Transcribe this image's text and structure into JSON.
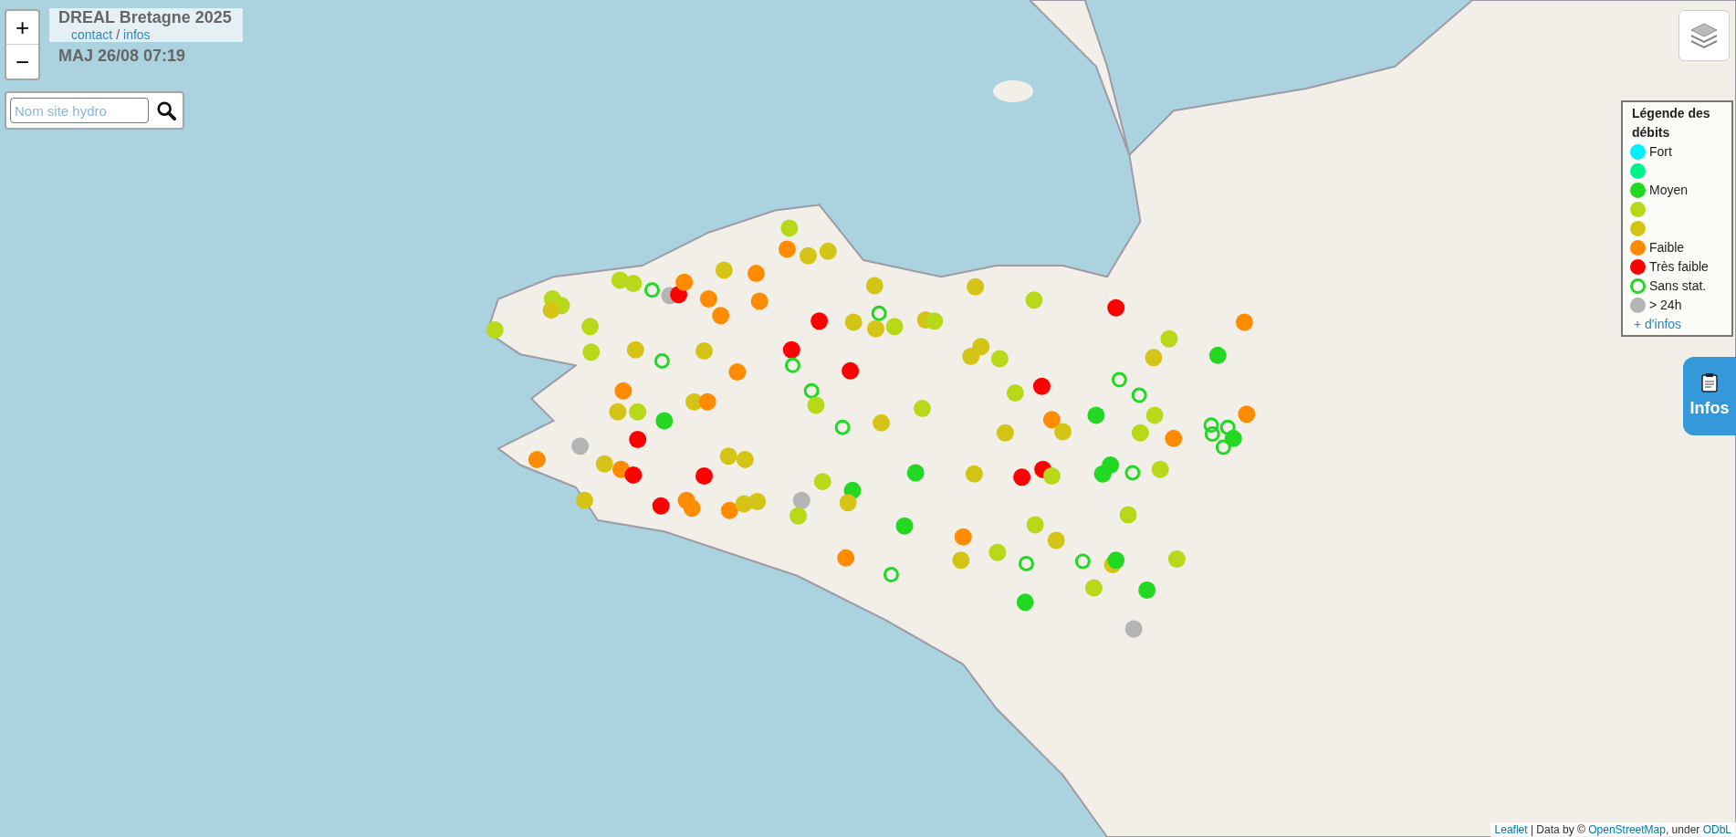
{
  "header": {
    "title": "DREAL Bretagne 2025",
    "links": [
      {
        "label": "contact"
      },
      {
        "label": "infos"
      }
    ],
    "separator": "/",
    "update": "MAJ 26/08 07:19"
  },
  "zoom": {
    "in": "+",
    "out": "−"
  },
  "search": {
    "placeholder": "Nom site hydro"
  },
  "legend": {
    "title": "Légende des débits",
    "more": "+ d'infos",
    "items": [
      {
        "kind": "dot",
        "color": "#00f0ff",
        "label": "Fort"
      },
      {
        "kind": "dot",
        "color": "#00f08c"
      },
      {
        "kind": "dot",
        "color": "#22d822",
        "label": "Moyen"
      },
      {
        "kind": "dot",
        "color": "#b8d81a"
      },
      {
        "kind": "dot",
        "color": "#d4c416"
      },
      {
        "kind": "dot",
        "color": "#ff8c00",
        "label": "Faible"
      },
      {
        "kind": "dot",
        "color": "#ff0000",
        "label": "Très faible"
      },
      {
        "kind": "ring",
        "color": "#22d822",
        "label": "Sans stat."
      },
      {
        "kind": "dot",
        "color": "#b4b4b4",
        "label": "> 24h"
      }
    ]
  },
  "infos_button": {
    "label": "Infos"
  },
  "attribution": {
    "parts": [
      {
        "kind": "link",
        "text": "Leaflet"
      },
      {
        "kind": "text",
        "text": " | Data by © "
      },
      {
        "kind": "link",
        "text": "OpenStreetMap"
      },
      {
        "kind": "text",
        "text": ", under "
      },
      {
        "kind": "link",
        "text": "ODbL"
      }
    ]
  },
  "stations": [
    {
      "kind": "dot",
      "color": "#b8d81a"
    },
    {
      "kind": "dot",
      "color": "#ff8c00"
    },
    {
      "kind": "dot",
      "color": "#d4c416"
    },
    {
      "kind": "dot",
      "color": "#d4c416"
    },
    {
      "kind": "dot",
      "color": "#d4c416"
    },
    {
      "kind": "dot",
      "color": "#ff8c00"
    },
    {
      "kind": "dot",
      "color": "#b8d81a"
    },
    {
      "kind": "dot",
      "color": "#b8d81a"
    },
    {
      "kind": "ring",
      "color": "#22d822"
    },
    {
      "kind": "dot",
      "color": "#b4b4b4"
    },
    {
      "kind": "dot",
      "color": "#ff0000"
    },
    {
      "kind": "dot",
      "color": "#ff8c00"
    },
    {
      "kind": "dot",
      "color": "#ff8c00"
    },
    {
      "kind": "dot",
      "color": "#ff8c00"
    },
    {
      "kind": "dot",
      "color": "#b8d81a"
    },
    {
      "kind": "dot",
      "color": "#b8d81a"
    },
    {
      "kind": "dot",
      "color": "#d4c416"
    },
    {
      "kind": "dot",
      "color": "#b8d81a"
    },
    {
      "kind": "dot",
      "color": "#b8d81a"
    },
    {
      "kind": "dot",
      "color": "#ff8c00"
    },
    {
      "kind": "dot",
      "color": "#ff0000"
    },
    {
      "kind": "dot",
      "color": "#d4c416"
    },
    {
      "kind": "dot",
      "color": "#d4c416"
    },
    {
      "kind": "ring",
      "color": "#22d822"
    },
    {
      "kind": "dot",
      "color": "#d4c416"
    },
    {
      "kind": "dot",
      "color": "#b8d81a"
    },
    {
      "kind": "dot",
      "color": "#d4c416"
    },
    {
      "kind": "dot",
      "color": "#b8d81a"
    },
    {
      "kind": "dot",
      "color": "#d4c416"
    },
    {
      "kind": "dot",
      "color": "#b8d81a"
    },
    {
      "kind": "dot",
      "color": "#ff0000"
    },
    {
      "kind": "dot",
      "color": "#ff8c00"
    },
    {
      "kind": "dot",
      "color": "#b8d81a"
    },
    {
      "kind": "dot",
      "color": "#22d822"
    },
    {
      "kind": "dot",
      "color": "#d4c416"
    },
    {
      "kind": "dot",
      "color": "#d4c416"
    },
    {
      "kind": "dot",
      "color": "#d4c416"
    },
    {
      "kind": "dot",
      "color": "#b8d81a"
    },
    {
      "kind": "dot",
      "color": "#d4c416"
    },
    {
      "kind": "dot",
      "color": "#b8d81a"
    },
    {
      "kind": "ring",
      "color": "#22d822"
    },
    {
      "kind": "dot",
      "color": "#d4c416"
    },
    {
      "kind": "dot",
      "color": "#ff0000"
    },
    {
      "kind": "ring",
      "color": "#22d822"
    },
    {
      "kind": "dot",
      "color": "#ff0000"
    },
    {
      "kind": "dot",
      "color": "#ff8c00"
    },
    {
      "kind": "dot",
      "color": "#ff8c00"
    },
    {
      "kind": "ring",
      "color": "#22d822"
    },
    {
      "kind": "dot",
      "color": "#d4c416"
    },
    {
      "kind": "dot",
      "color": "#ff8c00"
    },
    {
      "kind": "dot",
      "color": "#d4c416"
    },
    {
      "kind": "dot",
      "color": "#b8d81a"
    },
    {
      "kind": "dot",
      "color": "#22d822"
    },
    {
      "kind": "dot",
      "color": "#b8d81a"
    },
    {
      "kind": "dot",
      "color": "#b8d81a"
    },
    {
      "kind": "dot",
      "color": "#b8d81a"
    },
    {
      "kind": "dot",
      "color": "#ff0000"
    },
    {
      "kind": "ring",
      "color": "#22d822"
    },
    {
      "kind": "ring",
      "color": "#22d822"
    },
    {
      "kind": "dot",
      "color": "#22d822"
    },
    {
      "kind": "dot",
      "color": "#b8d81a"
    },
    {
      "kind": "dot",
      "color": "#ff8c00"
    },
    {
      "kind": "dot",
      "color": "#d4c416"
    },
    {
      "kind": "dot",
      "color": "#d4c416"
    },
    {
      "kind": "ring",
      "color": "#22d822"
    },
    {
      "kind": "dot",
      "color": "#d4c416"
    },
    {
      "kind": "dot",
      "color": "#b8d81a"
    },
    {
      "kind": "dot",
      "color": "#ff8c00"
    },
    {
      "kind": "ring",
      "color": "#22d822"
    },
    {
      "kind": "ring",
      "color": "#22d822"
    },
    {
      "kind": "ring",
      "color": "#22d822"
    },
    {
      "kind": "dot",
      "color": "#22d822"
    },
    {
      "kind": "dot",
      "color": "#ff8c00"
    },
    {
      "kind": "ring",
      "color": "#22d822"
    },
    {
      "kind": "dot",
      "color": "#ff0000"
    },
    {
      "kind": "dot",
      "color": "#b4b4b4"
    },
    {
      "kind": "dot",
      "color": "#ff8c00"
    },
    {
      "kind": "dot",
      "color": "#d4c416"
    },
    {
      "kind": "dot",
      "color": "#ff8c00"
    },
    {
      "kind": "dot",
      "color": "#ff0000"
    },
    {
      "kind": "dot",
      "color": "#ff0000"
    },
    {
      "kind": "dot",
      "color": "#d4c416"
    },
    {
      "kind": "dot",
      "color": "#d4c416"
    },
    {
      "kind": "dot",
      "color": "#b8d81a"
    },
    {
      "kind": "dot",
      "color": "#22d822"
    },
    {
      "kind": "dot",
      "color": "#22d822"
    },
    {
      "kind": "dot",
      "color": "#d4c416"
    },
    {
      "kind": "dot",
      "color": "#ff0000"
    },
    {
      "kind": "dot",
      "color": "#ff0000"
    },
    {
      "kind": "dot",
      "color": "#b8d81a"
    },
    {
      "kind": "dot",
      "color": "#22d822"
    },
    {
      "kind": "dot",
      "color": "#22d822"
    },
    {
      "kind": "ring",
      "color": "#22d822"
    },
    {
      "kind": "dot",
      "color": "#b8d81a"
    },
    {
      "kind": "dot",
      "color": "#d4c416"
    },
    {
      "kind": "dot",
      "color": "#ff0000"
    },
    {
      "kind": "dot",
      "color": "#ff8c00"
    },
    {
      "kind": "dot",
      "color": "#ff8c00"
    },
    {
      "kind": "dot",
      "color": "#ff8c00"
    },
    {
      "kind": "dot",
      "color": "#d4c416"
    },
    {
      "kind": "dot",
      "color": "#d4c416"
    },
    {
      "kind": "dot",
      "color": "#b4b4b4"
    },
    {
      "kind": "dot",
      "color": "#d4c416"
    },
    {
      "kind": "dot",
      "color": "#b8d81a"
    },
    {
      "kind": "dot",
      "color": "#b8d81a"
    },
    {
      "kind": "dot",
      "color": "#b8d81a"
    },
    {
      "kind": "dot",
      "color": "#22d822"
    },
    {
      "kind": "dot",
      "color": "#ff8c00"
    },
    {
      "kind": "dot",
      "color": "#d4c416"
    },
    {
      "kind": "dot",
      "color": "#b8d81a"
    },
    {
      "kind": "dot",
      "color": "#d4c416"
    },
    {
      "kind": "dot",
      "color": "#ff8c00"
    },
    {
      "kind": "ring",
      "color": "#22d822"
    },
    {
      "kind": "ring",
      "color": "#22d822"
    },
    {
      "kind": "ring",
      "color": "#22d822"
    },
    {
      "kind": "dot",
      "color": "#d4c416"
    },
    {
      "kind": "dot",
      "color": "#22d822"
    },
    {
      "kind": "dot",
      "color": "#b8d81a"
    },
    {
      "kind": "dot",
      "color": "#b8d81a"
    },
    {
      "kind": "dot",
      "color": "#22d822"
    },
    {
      "kind": "dot",
      "color": "#22d822"
    },
    {
      "kind": "dot",
      "color": "#b4b4b4"
    }
  ]
}
